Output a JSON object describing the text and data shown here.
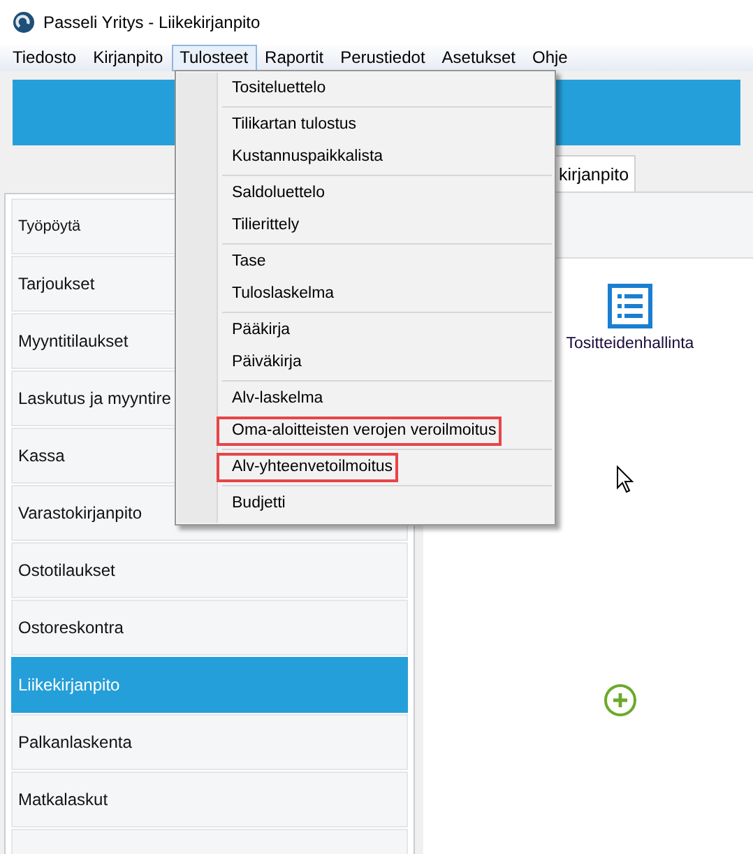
{
  "window": {
    "title": "Passeli Yritys - Liikekirjanpito"
  },
  "menubar": [
    {
      "label": "Tiedosto",
      "selected": false
    },
    {
      "label": "Kirjanpito",
      "selected": false
    },
    {
      "label": "Tulosteet",
      "selected": true
    },
    {
      "label": "Raportit",
      "selected": false
    },
    {
      "label": "Perustiedot",
      "selected": false
    },
    {
      "label": "Asetukset",
      "selected": false
    },
    {
      "label": "Ohje",
      "selected": false
    }
  ],
  "dropdown": {
    "groups": [
      [
        {
          "label": "Tositeluettelo",
          "highlighted": false
        }
      ],
      [
        {
          "label": "Tilikartan tulostus",
          "highlighted": false
        },
        {
          "label": "Kustannuspaikkalista",
          "highlighted": false
        }
      ],
      [
        {
          "label": "Saldoluettelo",
          "highlighted": false
        },
        {
          "label": "Tilierittely",
          "highlighted": false
        }
      ],
      [
        {
          "label": "Tase",
          "highlighted": false
        },
        {
          "label": "Tuloslaskelma",
          "highlighted": false
        }
      ],
      [
        {
          "label": "Pääkirja",
          "highlighted": false
        },
        {
          "label": "Päiväkirja",
          "highlighted": false
        }
      ],
      [
        {
          "label": "Alv-laskelma",
          "highlighted": false
        },
        {
          "label": "Oma-aloitteisten verojen veroilmoitus",
          "highlighted": true
        }
      ],
      [
        {
          "label": "Alv-yhteenvetoilmoitus",
          "highlighted": true
        }
      ],
      [
        {
          "label": "Budjetti",
          "highlighted": false
        }
      ]
    ]
  },
  "tabs": [
    {
      "label": "kirjanpito",
      "selected": true
    }
  ],
  "sidebar": {
    "items": [
      {
        "label": "Työpöytä",
        "kind": "header",
        "selected": false
      },
      {
        "label": "Tarjoukset",
        "kind": "module",
        "selected": false
      },
      {
        "label": "Myyntitilaukset",
        "kind": "module",
        "selected": false
      },
      {
        "label": "Laskutus ja myyntire",
        "kind": "module",
        "selected": false
      },
      {
        "label": "Kassa",
        "kind": "module",
        "selected": false
      },
      {
        "label": "Varastokirjanpito",
        "kind": "module",
        "selected": false
      },
      {
        "label": "Ostotilaukset",
        "kind": "module",
        "selected": false
      },
      {
        "label": "Ostoreskontra",
        "kind": "module",
        "selected": false
      },
      {
        "label": "Liikekirjanpito",
        "kind": "module",
        "selected": true
      },
      {
        "label": "Palkanlaskenta",
        "kind": "module",
        "selected": false
      },
      {
        "label": "Matkalaskut",
        "kind": "module",
        "selected": false
      }
    ]
  },
  "workspace": {
    "shortcuts": [
      {
        "label": "Tositteidenhallinta"
      }
    ]
  }
}
